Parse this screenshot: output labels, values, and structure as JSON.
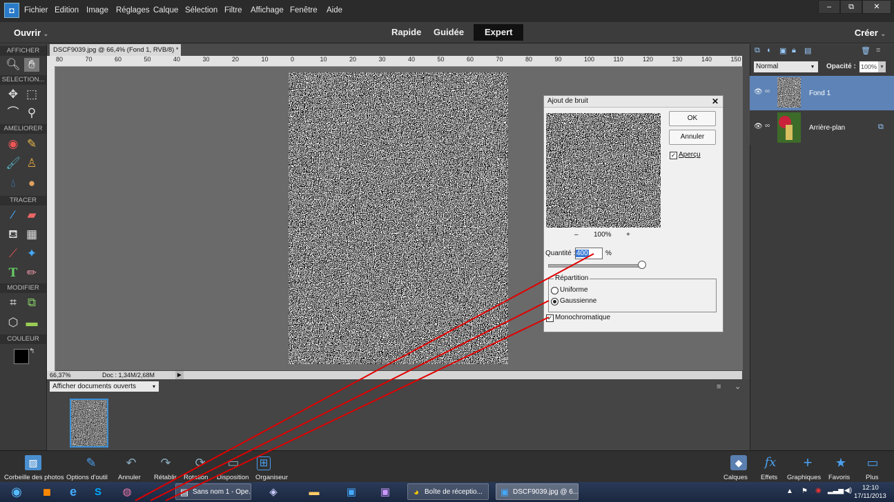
{
  "menubar": {
    "items": [
      "Fichier",
      "Edition",
      "Image",
      "Réglages",
      "Calque",
      "Sélection",
      "Filtre",
      "Affichage",
      "Fenêtre",
      "Aide"
    ],
    "window_controls": [
      "–",
      "⧉",
      "✕"
    ]
  },
  "modebar": {
    "open_label": "Ouvrir",
    "tabs": [
      "Rapide",
      "Guidée",
      "Expert"
    ],
    "create_label": "Créer"
  },
  "toolbar": {
    "sections": [
      "AFFICHER",
      "SELECTION...",
      "AMELIORER",
      "TRACER",
      "MODIFIER",
      "COULEUR"
    ]
  },
  "document": {
    "tab_title": "DSCF9039.jpg @ 66,4% (Fond 1, RVB/8) *",
    "tab_close": "×",
    "ruler_marks": [
      "80",
      "70",
      "60",
      "50",
      "40",
      "30",
      "20",
      "10",
      "0",
      "10",
      "20",
      "30",
      "40",
      "50",
      "60",
      "70",
      "80",
      "90",
      "100",
      "110",
      "120",
      "130",
      "140",
      "150"
    ],
    "zoom": "66,37%",
    "doc_size": "Doc : 1,34M/2,68M"
  },
  "bin": {
    "dropdown_label": "Afficher documents ouverts"
  },
  "dialog": {
    "title": "Ajout de bruit",
    "ok_label": "OK",
    "cancel_label": "Annuler",
    "preview_label": "Aperçu",
    "preview_checked": true,
    "zoom_minus": "–",
    "zoom_value": "100%",
    "zoom_plus": "+",
    "amount_label": "Quantité :",
    "amount_value": "400",
    "amount_unit": "%",
    "amount_fraction": 1.0,
    "distribution_label": "Répartition",
    "uniform_label": "Uniforme",
    "gaussian_label": "Gaussienne",
    "gaussian_selected": true,
    "mono_label": "Monochromatique",
    "mono_checked": true
  },
  "layers": {
    "blend_mode": "Normal",
    "opacity_label": "Opacité :",
    "opacity_value": "100%",
    "items": [
      {
        "name": "Fond 1",
        "selected": true
      },
      {
        "name": "Arrière-plan",
        "selected": false
      }
    ]
  },
  "actionbar": {
    "left": [
      "Corbeille des photos",
      "Options d'outil",
      "Annuler",
      "Rétablir",
      "Rotation",
      "Disposition",
      "Organiseur"
    ],
    "right": [
      "Calques",
      "Effets",
      "Graphiques",
      "Favoris",
      "Plus"
    ]
  },
  "taskbar": {
    "windows": [
      "Sans nom 1 - Ope...",
      "Boîte de réceptio...",
      "DSCF9039.jpg @ 6..."
    ],
    "time": "12:10",
    "date": "17/11/2013"
  },
  "colors": {
    "accent_blue": "#5e84b7",
    "arrow_red": "#e00000",
    "taskbar": "#1f2d48"
  }
}
